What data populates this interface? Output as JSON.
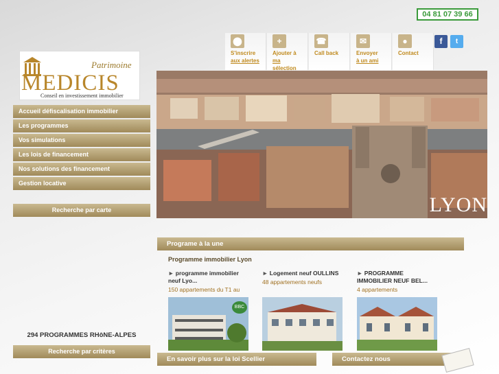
{
  "header": {
    "phone": "04 81 07 39 66",
    "tools": [
      {
        "icon": "location-pin-icon",
        "line1": "S'inscrire",
        "line2": "aux alertes"
      },
      {
        "icon": "plus-icon",
        "line1": "Ajouter à",
        "line2": "ma sélection"
      },
      {
        "icon": "phone-icon",
        "line1": "Call back",
        "line2": ""
      },
      {
        "icon": "mail-icon",
        "line1": "Envoyer",
        "line2": "à un ami"
      },
      {
        "icon": "person-icon",
        "line1": "Contact",
        "line2": ""
      }
    ],
    "social": {
      "facebook": "f",
      "twitter": "t"
    }
  },
  "logo": {
    "patrimoine": "Patrimoine",
    "name": "MEDICIS",
    "tagline": "Conseil en investissement immobilier"
  },
  "menu": [
    "Accueil défiscalisation immobilier",
    "Les programmes",
    "Vos simulations",
    "Les lois de financement",
    "Nos solutions des financement",
    "Gestion locative"
  ],
  "sidebar": {
    "map_search": "Recherche par carte",
    "count": "294 PROGRAMMES RHôNE-ALPES",
    "criteria_search": "Recherche par critères"
  },
  "hero": {
    "city": "LYON"
  },
  "featured": {
    "bar_title": "Programe à la une",
    "title": "Programme immobilier Lyon",
    "cards": [
      {
        "title": "programme immobilier neuf Lyo...",
        "subtitle": "150 appartements du T1 au",
        "badge": "BBC"
      },
      {
        "title": "Logement neuf OULLINS",
        "subtitle": "48 appartements neufs"
      },
      {
        "title": "PROGRAMME IMMOBILIER NEUF BEL...",
        "subtitle": "4 appartements"
      }
    ]
  },
  "footer": {
    "scellier": "En savoir plus sur la loi Scellier",
    "contact": "Contactez nous"
  },
  "colors": {
    "gold": "#b8862b",
    "button": "#a08a5a",
    "phone_border": "#3a9a3a"
  }
}
